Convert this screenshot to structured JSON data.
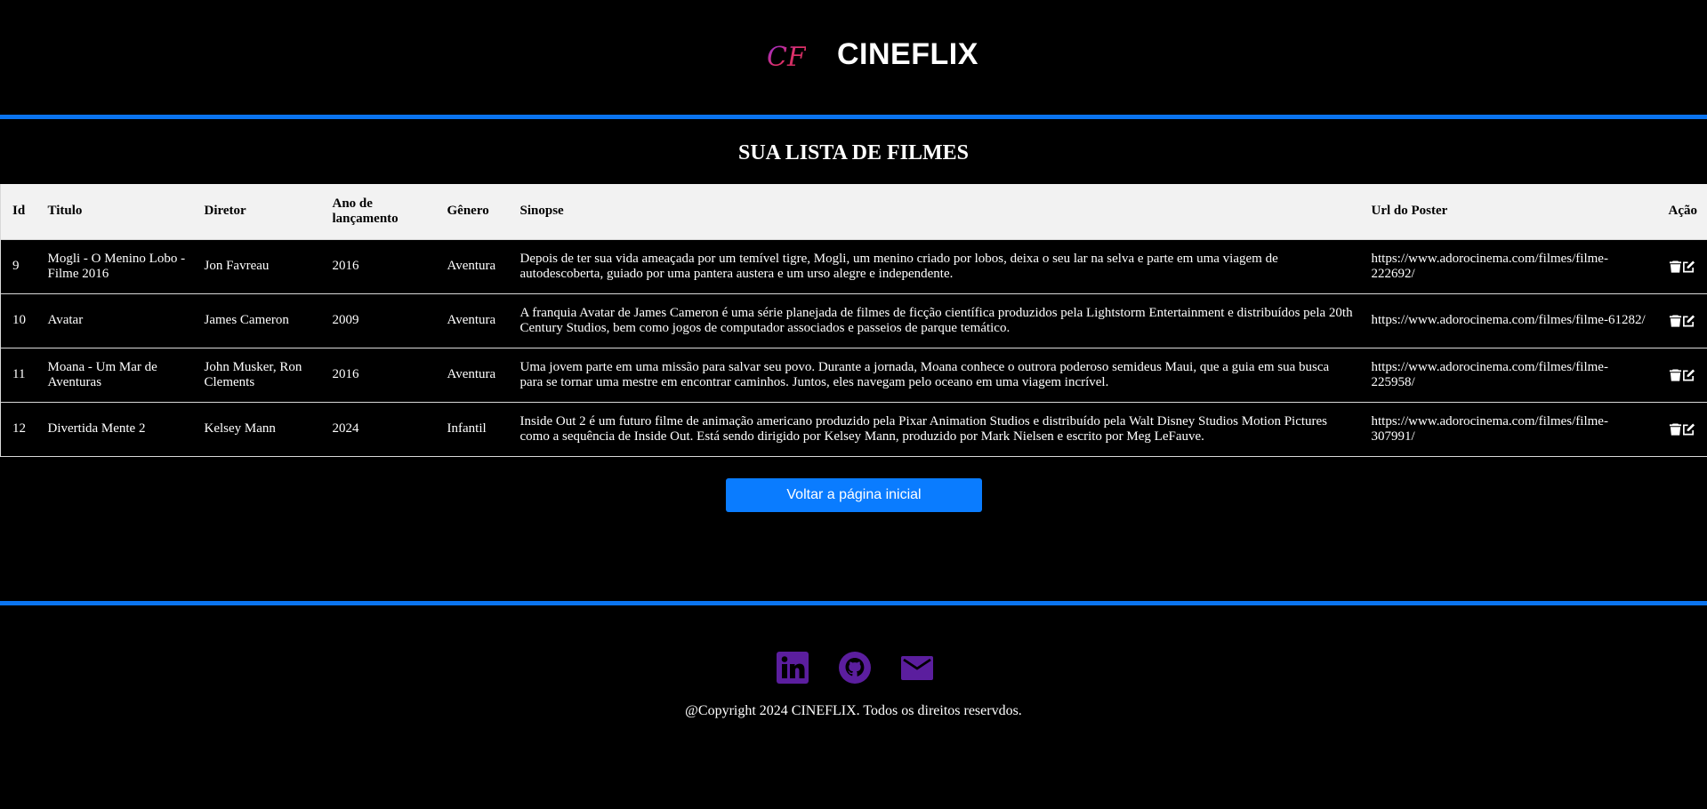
{
  "header": {
    "brand": "CINEFLIX",
    "logo_text": "CF"
  },
  "page_title": "SUA LISTA DE FILMES",
  "table": {
    "columns": [
      "Id",
      "Titulo",
      "Diretor",
      "Ano de lançamento",
      "Gênero",
      "Sinopse",
      "Url do Poster",
      "Ação"
    ],
    "rows": [
      {
        "id": "9",
        "titulo": "Mogli - O Menino Lobo - Filme 2016",
        "diretor": "Jon Favreau",
        "ano": "2016",
        "genero": "Aventura",
        "sinopse": "Depois de ter sua vida ameaçada por um temível tigre, Mogli, um menino criado por lobos, deixa o seu lar na selva e parte em uma viagem de autodescoberta, guiado por uma pantera austera e um urso alegre e independente.",
        "url": "https://www.adorocinema.com/filmes/filme-222692/"
      },
      {
        "id": "10",
        "titulo": "Avatar",
        "diretor": "James Cameron",
        "ano": "2009",
        "genero": "Aventura",
        "sinopse": "A franquia Avatar de James Cameron é uma série planejada de filmes de ficção científica produzidos pela Lightstorm Entertainment e distribuídos pela 20th Century Studios, bem como jogos de computador associados e passeios de parque temático.",
        "url": "https://www.adorocinema.com/filmes/filme-61282/"
      },
      {
        "id": "11",
        "titulo": "Moana - Um Mar de Aventuras",
        "diretor": "John Musker, Ron Clements",
        "ano": "2016",
        "genero": "Aventura",
        "sinopse": "Uma jovem parte em uma missão para salvar seu povo. Durante a jornada, Moana conhece o outrora poderoso semideus Maui, que a guia em sua busca para se tornar uma mestre em encontrar caminhos. Juntos, eles navegam pelo oceano em uma viagem incrível.",
        "url": "https://www.adorocinema.com/filmes/filme-225958/"
      },
      {
        "id": "12",
        "titulo": "Divertida Mente 2",
        "diretor": "Kelsey Mann",
        "ano": "2024",
        "genero": "Infantil",
        "sinopse": "Inside Out 2 é um futuro filme de animação americano produzido pela Pixar Animation Studios e distribuído pela Walt Disney Studios Motion Pictures como a sequência de Inside Out. Está sendo dirigido por Kelsey Mann, produzido por Mark Nielsen e escrito por Meg LeFauve.",
        "url": "https://www.adorocinema.com/filmes/filme-307991/"
      }
    ],
    "row_actions": [
      "trash-icon",
      "edit-icon"
    ]
  },
  "back_button": "Voltar a página inicial",
  "footer": {
    "social_icons": [
      "linkedin-icon",
      "github-icon",
      "mail-icon"
    ],
    "icon_color": "#5b1e9e",
    "copyright": "@Copyright 2024 CINEFLIX. Todos os direitos reservdos."
  },
  "colors": {
    "accent": "#0a74f0",
    "button": "#0a7cff",
    "background": "#000000",
    "header_row": "#f2f2f2"
  }
}
